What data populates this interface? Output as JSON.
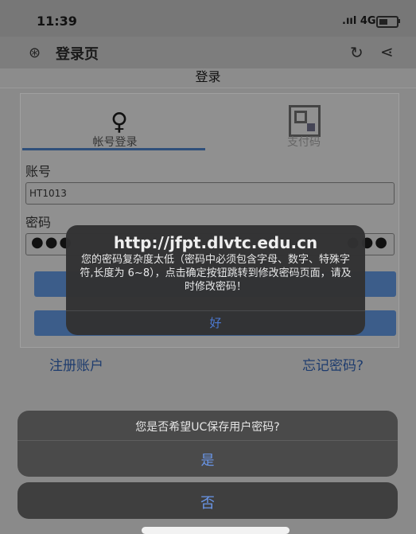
{
  "status": {
    "time": "11:39",
    "signal": ".ııl 4G"
  },
  "nav": {
    "title": "登录页"
  },
  "page": {
    "subtitle": "登录",
    "tabs": [
      {
        "label": "帐号登录"
      },
      {
        "label": "支付码"
      }
    ],
    "account_label": "账号",
    "account_value": "HT1013",
    "password_label": "密码",
    "password_masked": "●●●",
    "password_masked_end": "●●●",
    "register_link": "注册账户",
    "forgot_link": "忘记密码?"
  },
  "alert": {
    "title": "http://jfpt.dlvtc.edu.cn",
    "message": "您的密码复杂度太低（密码中必须包含字母、数字、特殊字符,长度为 6~8），点击确定按钮跳转到修改密码页面，请及时修改密码！",
    "ok": "好"
  },
  "sheet": {
    "message": "您是否希望UC保存用户密码?",
    "yes": "是",
    "no": "否"
  }
}
